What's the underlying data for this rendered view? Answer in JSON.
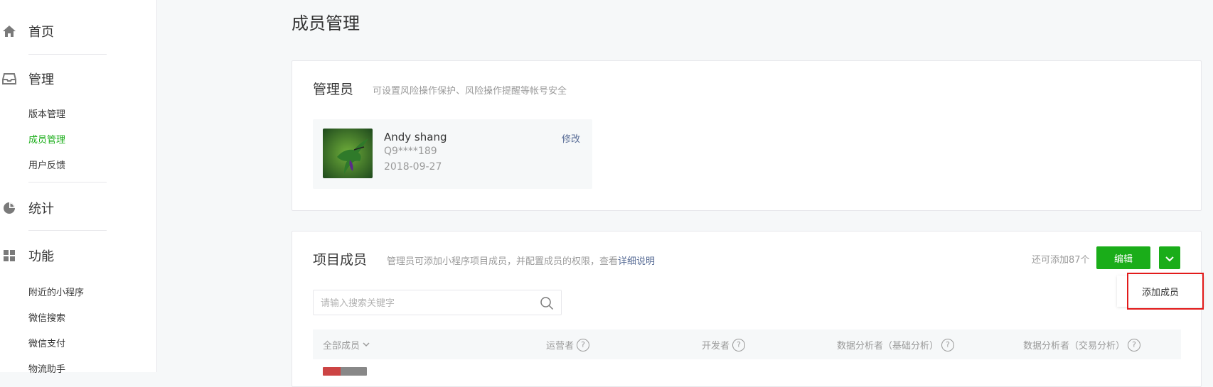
{
  "page": {
    "title": "成员管理"
  },
  "sidebar": {
    "home": {
      "label": "首页",
      "icon": "home-icon"
    },
    "manage": {
      "label": "管理",
      "icon": "inbox-icon"
    },
    "manage_items": [
      "版本管理",
      "成员管理",
      "用户反馈"
    ],
    "stats": {
      "label": "统计",
      "icon": "pie-chart-icon"
    },
    "features": {
      "label": "功能",
      "icon": "grid-icon"
    },
    "feature_items": [
      "附近的小程序",
      "微信搜索",
      "微信支付",
      "物流助手"
    ],
    "active_item": "成员管理"
  },
  "admin": {
    "title": "管理员",
    "desc": "可设置风险操作保护、风险操作提醒等帐号安全",
    "name": "Andy shang",
    "id": "Q9****189",
    "date": "2018-09-27",
    "edit_label": "修改"
  },
  "members": {
    "title": "项目成员",
    "desc": "管理员可添加小程序项目成员，并配置成员的权限，查看",
    "desc_link": "详细说明",
    "remaining": "还可添加87个",
    "edit_button": "编辑",
    "search_placeholder": "请输入搜索关键字",
    "columns": [
      "全部成员",
      "运营者",
      "开发者",
      "数据分析者（基础分析）",
      "数据分析者（交易分析）"
    ],
    "dropdown_item": "添加成员"
  },
  "colors": {
    "accent": "#1aad19",
    "link": "#576b95",
    "highlight": "#e21a1a"
  }
}
